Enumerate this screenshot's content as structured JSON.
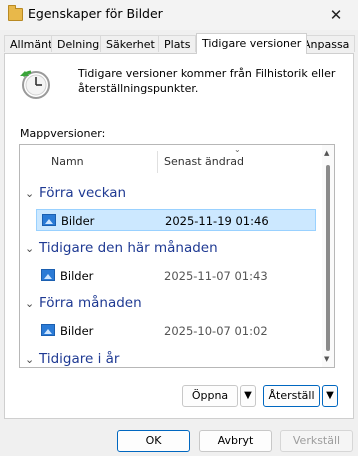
{
  "window": {
    "title": "Egenskaper för Bilder",
    "close_glyph": "✕"
  },
  "tabs": [
    {
      "label": "Allmänt",
      "active": false
    },
    {
      "label": "Delning",
      "active": false
    },
    {
      "label": "Säkerhet",
      "active": false
    },
    {
      "label": "Plats",
      "active": false
    },
    {
      "label": "Tidigare versioner",
      "active": true
    },
    {
      "label": "Anpassa",
      "active": false
    }
  ],
  "info": {
    "icon": "clock-restore-icon",
    "description": "Tidigare versioner kommer från Filhistorik eller återställningspunkter."
  },
  "folder_versions": {
    "label": "Mappversioner:",
    "columns": {
      "name": "Namn",
      "modified": "Senast ändrad"
    },
    "groups": [
      {
        "label": "Förra veckan",
        "items": [
          {
            "name": "Bilder",
            "date": "2025-11-19 01:46",
            "selected": true
          }
        ]
      },
      {
        "label": "Tidigare den här månaden",
        "items": [
          {
            "name": "Bilder",
            "date": "2025-11-07 01:43",
            "selected": false
          }
        ]
      },
      {
        "label": "Förra månaden",
        "items": [
          {
            "name": "Bilder",
            "date": "2025-10-07 01:02",
            "selected": false
          }
        ]
      },
      {
        "label": "Tidigare i år",
        "items": []
      }
    ]
  },
  "actions": {
    "open_label": "Öppna",
    "restore_label": "Återställ"
  },
  "footer": {
    "ok_label": "OK",
    "cancel_label": "Avbryt",
    "apply_label": "Verkställ"
  },
  "colors": {
    "accent": "#0067c0",
    "group_header": "#1f3a93",
    "selection": "#cce8ff"
  }
}
